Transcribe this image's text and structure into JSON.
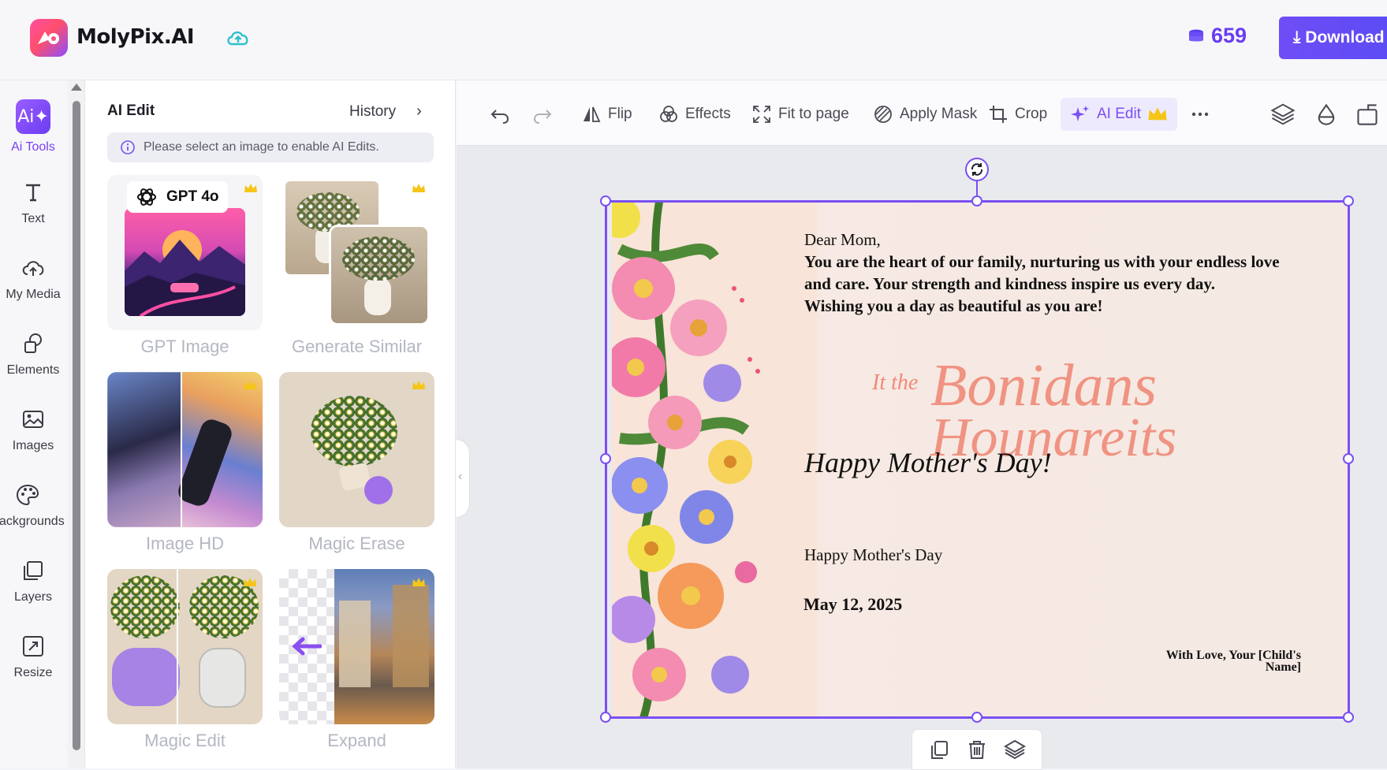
{
  "app": {
    "name": "MolyPix.AI",
    "credits": "659",
    "download_label": "Download"
  },
  "sidebar": {
    "items": [
      {
        "label": "Ai Tools",
        "icon": "ai-icon",
        "active": true
      },
      {
        "label": "Text",
        "icon": "text-icon"
      },
      {
        "label": "My Media",
        "icon": "upload-cloud-icon"
      },
      {
        "label": "Elements",
        "icon": "shapes-icon"
      },
      {
        "label": "Images",
        "icon": "image-icon"
      },
      {
        "label": "Backgrounds",
        "icon": "palette-icon"
      },
      {
        "label": "Layers",
        "icon": "layers-icon"
      },
      {
        "label": "Resize",
        "icon": "resize-icon"
      }
    ]
  },
  "panel": {
    "title": "AI Edit",
    "history_label": "History",
    "notice": "Please select an image to enable AI Edits.",
    "gpt_badge": "GPT 4o",
    "tools": [
      {
        "label": "GPT Image",
        "premium": true
      },
      {
        "label": "Generate Similar",
        "premium": true
      },
      {
        "label": "Image HD",
        "premium": true
      },
      {
        "label": "Magic Erase",
        "premium": true
      },
      {
        "label": "Magic Edit",
        "premium": true
      },
      {
        "label": "Expand",
        "premium": true
      }
    ]
  },
  "toolbar": {
    "flip": "Flip",
    "effects": "Effects",
    "fit": "Fit to page",
    "mask": "Apply Mask",
    "crop": "Crop",
    "ai_edit": "AI Edit"
  },
  "card": {
    "greeting": "Dear Mom,",
    "body_line1": "You are the heart of our family, nurturing us with your endless love",
    "body_line2": "and care. Your strength and kindness inspire us every day.",
    "body_line3": "Wishing you a day as beautiful as you are!",
    "headline": "Happy Mother's Day!",
    "subtitle": "Happy Mother's Day",
    "date": "May 12, 2025",
    "signoff_line1": "With Love, Your [Child's",
    "signoff_line2": "Name]",
    "script_small": "It the",
    "script_large1": "Bonidans",
    "script_large2": "Hounareits"
  },
  "colors": {
    "accent": "#7a4ff3",
    "brand_pink": "#ff4fa3",
    "script": "#f08a78"
  }
}
